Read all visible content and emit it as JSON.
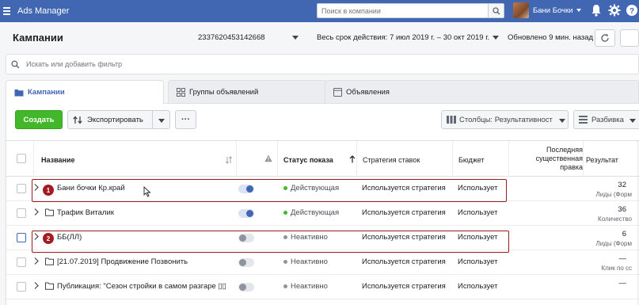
{
  "topbar": {
    "app_title": "Ads Manager",
    "search_placeholder": "Поиск в компании",
    "profile_name": "Бани Бочки"
  },
  "header": {
    "title": "Кампании",
    "account_id": "2337620453142668",
    "date_range": "Весь срок действия: 7 июл 2019 г. – 30 окт 2019 г.",
    "updated": "Обновлено 9 мин. назад"
  },
  "filter": {
    "placeholder": "Искать или добавить фильтр"
  },
  "tabs": [
    {
      "label": "Кампании",
      "active": true
    },
    {
      "label": "Группы объявлений",
      "active": false
    },
    {
      "label": "Объявления",
      "active": false
    }
  ],
  "toolbar": {
    "create_label": "Создать",
    "export_label": "Экспортировать",
    "more_label": "···",
    "columns_label": "Столбцы: Результативност",
    "breakdown_label": "Разбивка"
  },
  "table": {
    "headers": {
      "name": "Название",
      "status": "Статус показа",
      "strategy": "Стратегия ставок",
      "budget": "Бюджет",
      "last_edit": "Последняя существенная правка",
      "result": "Результат"
    },
    "rows": [
      {
        "name": "Бани бочки Кр.край",
        "folder": false,
        "toggle": "on",
        "status": "Действующая",
        "status_color": "#42b72a",
        "strategy": "Используется стратегия",
        "budget": "Использует",
        "result": "32",
        "result_sub": "Лиды (Форм"
      },
      {
        "name": "Трафик Виталик",
        "folder": true,
        "toggle": "on",
        "status": "Действующая",
        "status_color": "#42b72a",
        "strategy": "Используется стратегия",
        "budget": "Использует",
        "result": "36",
        "result_sub": "Количество"
      },
      {
        "name": "ББ(ЛЛ)",
        "folder": false,
        "toggle": "off",
        "status": "Неактивно",
        "status_color": "#8d949e",
        "strategy": "Используется стратегия",
        "budget": "Использует",
        "result": "6",
        "result_sub": "Лиды (Форм"
      },
      {
        "name": "[21.07.2019] Продвижение Позвонить",
        "folder": true,
        "toggle": "off",
        "status": "Неактивно",
        "status_color": "#8d949e",
        "strategy": "Используется стратегия",
        "budget": "Использует",
        "result": "—",
        "result_sub": "Клик по сс"
      },
      {
        "name": "Публикация: \"Сезон стройки в самом разгаре ▯▯",
        "folder": true,
        "toggle": "off",
        "status": "Неактивно",
        "status_color": "#8d949e",
        "strategy": "Используется стратегия",
        "budget": "Использует",
        "result": "—",
        "result_sub": ""
      }
    ]
  },
  "annotations": [
    "1",
    "2"
  ],
  "colors": {
    "topbar": "#4267b2",
    "create_button": "#42b72a",
    "annotation": "#9b1c20"
  }
}
